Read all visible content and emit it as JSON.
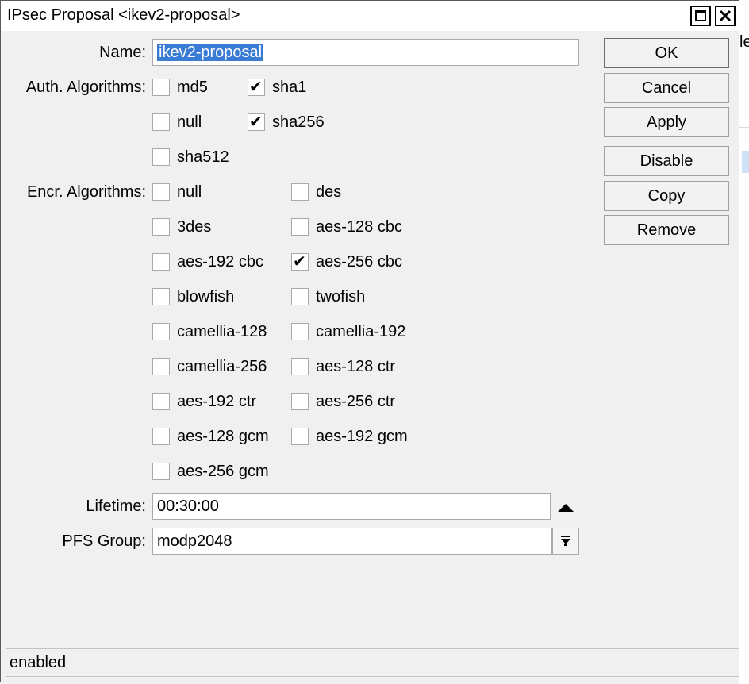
{
  "window": {
    "title": "IPsec Proposal <ikev2-proposal>"
  },
  "background": {
    "fragment_text": "le"
  },
  "form": {
    "name_label": "Name:",
    "name_value": "ikev2-proposal",
    "auth_label": "Auth. Algorithms:",
    "encr_label": "Encr. Algorithms:",
    "lifetime_label": "Lifetime:",
    "lifetime_value": "00:30:00",
    "pfs_label": "PFS Group:",
    "pfs_value": "modp2048"
  },
  "auth_algorithms": [
    {
      "label": "md5",
      "checked": false
    },
    {
      "label": "sha1",
      "checked": true
    },
    {
      "label": "null",
      "checked": false
    },
    {
      "label": "sha256",
      "checked": true
    },
    {
      "label": "sha512",
      "checked": false
    }
  ],
  "encr_algorithms": [
    {
      "label": "null",
      "checked": false
    },
    {
      "label": "des",
      "checked": false
    },
    {
      "label": "3des",
      "checked": false
    },
    {
      "label": "aes-128 cbc",
      "checked": false
    },
    {
      "label": "aes-192 cbc",
      "checked": false
    },
    {
      "label": "aes-256 cbc",
      "checked": true
    },
    {
      "label": "blowfish",
      "checked": false
    },
    {
      "label": "twofish",
      "checked": false
    },
    {
      "label": "camellia-128",
      "checked": false
    },
    {
      "label": "camellia-192",
      "checked": false
    },
    {
      "label": "camellia-256",
      "checked": false
    },
    {
      "label": "aes-128 ctr",
      "checked": false
    },
    {
      "label": "aes-192 ctr",
      "checked": false
    },
    {
      "label": "aes-256 ctr",
      "checked": false
    },
    {
      "label": "aes-128 gcm",
      "checked": false
    },
    {
      "label": "aes-192 gcm",
      "checked": false
    },
    {
      "label": "aes-256 gcm",
      "checked": false
    }
  ],
  "buttons": {
    "ok": "OK",
    "cancel": "Cancel",
    "apply": "Apply",
    "disable": "Disable",
    "copy": "Copy",
    "remove": "Remove"
  },
  "status": {
    "text": "enabled"
  },
  "icons": {
    "maximize": "maximize-icon",
    "close": "close-icon",
    "spin_up": "triangle-up-icon",
    "dropdown": "dropdown-arrow-icon",
    "check": "checkmark-icon"
  }
}
